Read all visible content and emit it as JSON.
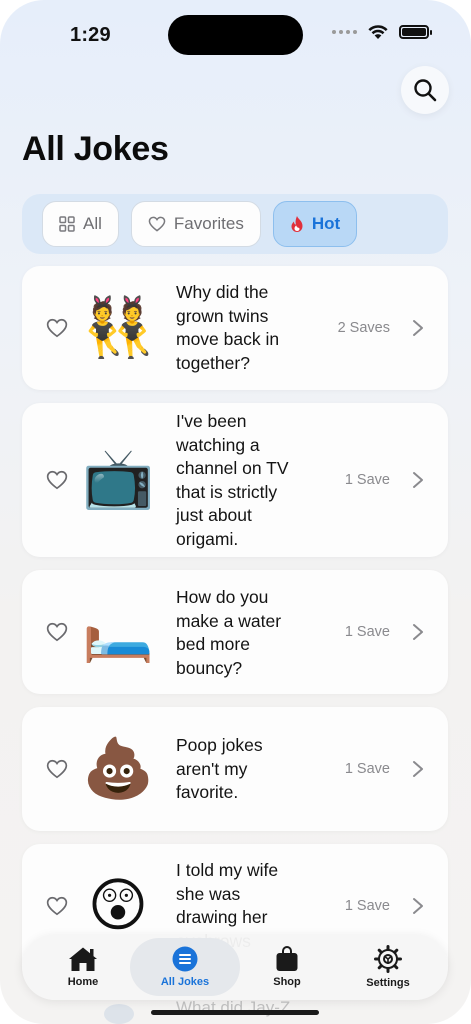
{
  "status_bar": {
    "time": "1:29"
  },
  "page": {
    "title": "All Jokes"
  },
  "filters": [
    {
      "label": "All",
      "icon": "grid-icon",
      "active": false
    },
    {
      "label": "Favorites",
      "icon": "heart-outline-icon",
      "active": false
    },
    {
      "label": "Hot",
      "icon": "flame-icon",
      "active": true
    }
  ],
  "jokes": [
    {
      "emoji": "👯",
      "text": "Why did the grown twins move back in together?",
      "saves": "2 Saves"
    },
    {
      "emoji": "📺",
      "text": "I've been watching a channel on TV that is strictly just about origami.",
      "saves": "1 Save"
    },
    {
      "emoji": "🛏️",
      "text": "How do you make a water bed more bouncy?",
      "saves": "1 Save"
    },
    {
      "emoji": "💩",
      "text": "Poop jokes aren't my favorite.",
      "saves": "1 Save"
    },
    {
      "emoji": "😲",
      "text": "I told my wife she was drawing her eyebrows",
      "saves": "1 Save"
    }
  ],
  "peek": {
    "text": "What did Jay-Z"
  },
  "tab_bar": {
    "items": [
      {
        "label": "Home",
        "icon": "house-icon"
      },
      {
        "label": "All Jokes",
        "icon": "list-circle-icon",
        "active": true
      },
      {
        "label": "Shop",
        "icon": "shopping-bag-icon"
      },
      {
        "label": "Settings",
        "icon": "gear-icon"
      }
    ]
  },
  "colors": {
    "accent": "#1a73d9",
    "hot": "#e0303c"
  }
}
